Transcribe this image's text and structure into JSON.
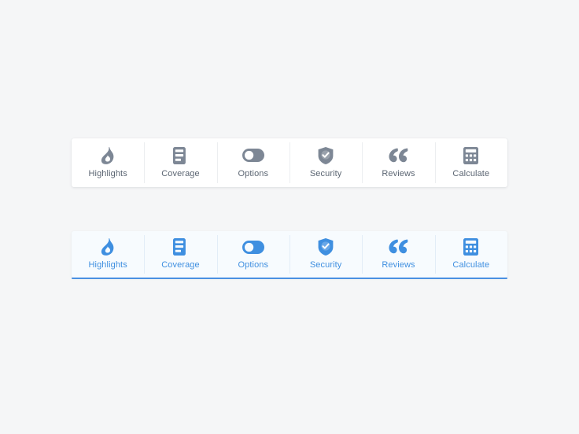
{
  "page": {
    "background_color": "#f5f6f7"
  },
  "colors": {
    "inactive_icon": "#7d8795",
    "inactive_label": "#5b6572",
    "active_icon": "#3f8fe0",
    "active_label": "#3f8fe0",
    "active_bar_background": "#f7fbfe",
    "active_underline": "#4a90e2",
    "card_background": "#ffffff",
    "divider_inactive": "#eceef0",
    "divider_active": "#e2edf7"
  },
  "tabbars": [
    {
      "id": "default",
      "state": "default",
      "tabs": [
        {
          "label": "Highlights",
          "icon": "flame-icon"
        },
        {
          "label": "Coverage",
          "icon": "document-list-icon"
        },
        {
          "label": "Options",
          "icon": "toggle-switch-icon"
        },
        {
          "label": "Security",
          "icon": "shield-check-icon"
        },
        {
          "label": "Reviews",
          "icon": "quote-icon"
        },
        {
          "label": "Calculate",
          "icon": "calculator-icon"
        }
      ]
    },
    {
      "id": "active",
      "state": "active",
      "tabs": [
        {
          "label": "Highlights",
          "icon": "flame-icon"
        },
        {
          "label": "Coverage",
          "icon": "document-list-icon"
        },
        {
          "label": "Options",
          "icon": "toggle-switch-icon"
        },
        {
          "label": "Security",
          "icon": "shield-check-icon"
        },
        {
          "label": "Reviews",
          "icon": "quote-icon"
        },
        {
          "label": "Calculate",
          "icon": "calculator-icon"
        }
      ]
    }
  ]
}
